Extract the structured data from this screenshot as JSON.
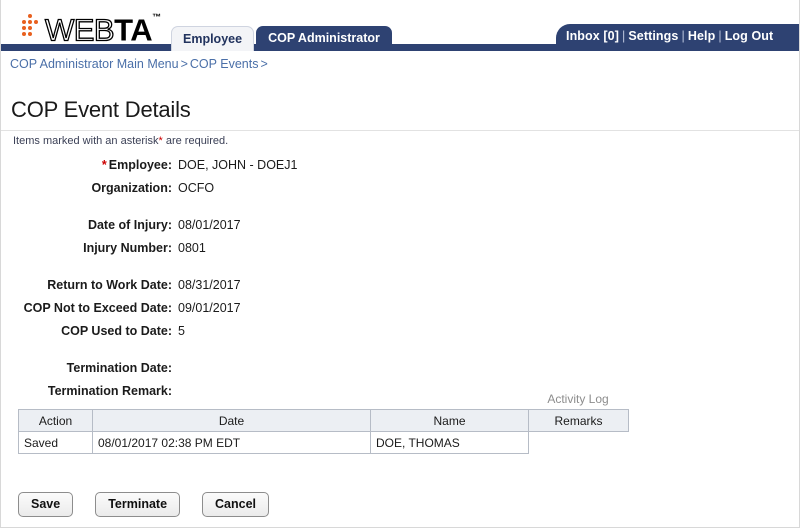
{
  "brand": {
    "logo_web": "WEB",
    "logo_ta": "TA",
    "logo_tm": "™",
    "dot_color": "#e8601f"
  },
  "header": {
    "tabs": [
      {
        "label": "Employee",
        "active": false
      },
      {
        "label": "COP Administrator",
        "active": true
      }
    ],
    "nav_links": [
      {
        "label": "Inbox [0]"
      },
      {
        "label": "Settings"
      },
      {
        "label": "Help"
      },
      {
        "label": "Log Out"
      }
    ],
    "nav_separator": "|",
    "navy_color": "#2e4272"
  },
  "breadcrumb": {
    "items": [
      {
        "label": "COP Administrator Main Menu"
      },
      {
        "label": "COP Events"
      }
    ],
    "separator": ">",
    "trailing_separator": ">",
    "link_color": "#4a6fa8"
  },
  "page": {
    "title": "COP Event Details",
    "required_note_prefix": "Items marked with an asterisk",
    "required_note_asterisk": "*",
    "required_note_suffix": " are required."
  },
  "form": {
    "fields": [
      {
        "required": true,
        "asterisk": "*",
        "label": "Employee:",
        "value": "DOE, JOHN - DOEJ1"
      },
      {
        "required": false,
        "asterisk": "",
        "label": "Organization:",
        "value": "OCFO"
      },
      {
        "required": false,
        "asterisk": "",
        "label": "Date of Injury:",
        "value": "08/01/2017"
      },
      {
        "required": false,
        "asterisk": "",
        "label": "Injury Number:",
        "value": "0801"
      },
      {
        "required": false,
        "asterisk": "",
        "label": "Return to Work Date:",
        "value": "08/31/2017"
      },
      {
        "required": false,
        "asterisk": "",
        "label": "COP Not to Exceed Date:",
        "value": "09/01/2017"
      },
      {
        "required": false,
        "asterisk": "",
        "label": "COP Used to Date:",
        "value": "5"
      },
      {
        "required": false,
        "asterisk": "",
        "label": "Termination Date:",
        "value": ""
      },
      {
        "required": false,
        "asterisk": "",
        "label": "Termination Remark:",
        "value": ""
      }
    ]
  },
  "activity_log": {
    "caption": "Activity Log",
    "columns": [
      "Action",
      "Date",
      "Name",
      "Remarks"
    ],
    "rows": [
      {
        "action": "Saved",
        "date": "08/01/2017 02:38 PM EDT",
        "name": "DOE, THOMAS",
        "remarks": ""
      }
    ]
  },
  "buttons": [
    {
      "label": "Save"
    },
    {
      "label": "Terminate"
    },
    {
      "label": "Cancel"
    }
  ]
}
